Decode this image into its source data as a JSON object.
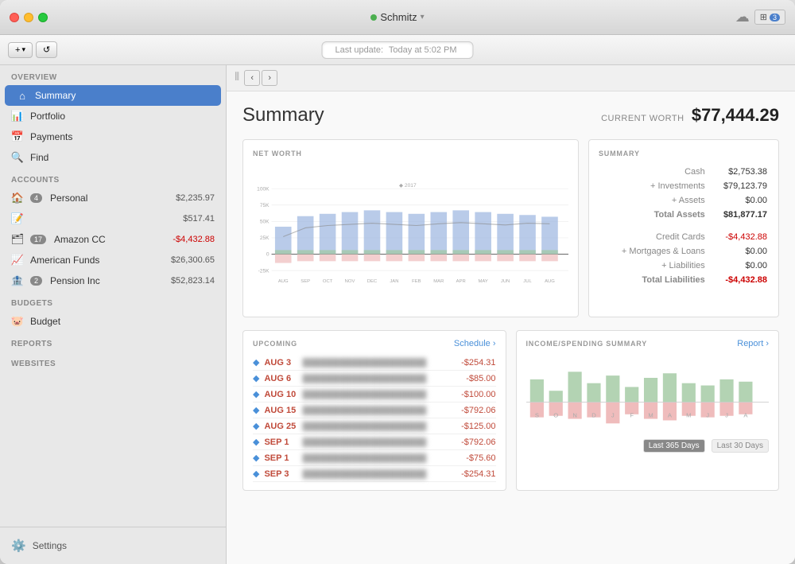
{
  "window": {
    "title": "Schmitz",
    "title_dot_color": "#4CAF50"
  },
  "toolbar": {
    "add_label": "+",
    "refresh_label": "↺",
    "last_update_label": "Last update:",
    "last_update_time": "Today at 5:02 PM"
  },
  "sidebar": {
    "overview_label": "Overview",
    "items": [
      {
        "id": "summary",
        "label": "Summary",
        "icon": "house",
        "active": true
      },
      {
        "id": "portfolio",
        "label": "Portfolio",
        "icon": "chart"
      },
      {
        "id": "payments",
        "label": "Payments",
        "icon": "calendar"
      },
      {
        "id": "find",
        "label": "Find",
        "icon": "search"
      }
    ],
    "accounts_label": "Accounts",
    "accounts": [
      {
        "id": "personal",
        "label": "Personal",
        "badge": "4",
        "amount": "$2,235.97",
        "negative": false
      },
      {
        "id": "personal2",
        "label": "",
        "badge": "",
        "amount": "$517.41",
        "negative": false
      },
      {
        "id": "amazon",
        "label": "Amazon CC",
        "badge": "17",
        "amount": "-$4,432.88",
        "negative": true
      },
      {
        "id": "american-funds",
        "label": "American Funds",
        "badge": "",
        "amount": "$26,300.65",
        "negative": false
      },
      {
        "id": "pension",
        "label": "Pension Inc",
        "badge": "2",
        "amount": "$52,823.14",
        "negative": false
      }
    ],
    "budgets_label": "Budgets",
    "budget_label": "Budget",
    "reports_label": "Reports",
    "websites_label": "Websites",
    "settings_label": "Settings"
  },
  "content": {
    "title": "Summary",
    "current_worth_label": "CURRENT WORTH",
    "current_worth_value": "$77,444.29",
    "net_worth_label": "NET WORTH",
    "summary_label": "SUMMARY",
    "summary_year": "2017",
    "chart_months": [
      "AUG",
      "SEP",
      "OCT",
      "NOV",
      "DEC",
      "JAN",
      "FEB",
      "MAR",
      "APR",
      "MAY",
      "JUN",
      "JUL",
      "AUG"
    ],
    "chart_y_labels": [
      "100K",
      "75K",
      "50K",
      "25K",
      "0",
      "-25K"
    ],
    "summary_rows": [
      {
        "label": "Cash",
        "value": "$2,753.38",
        "type": "normal"
      },
      {
        "label": "+ Investments",
        "value": "$79,123.79",
        "type": "normal"
      },
      {
        "label": "+ Assets",
        "value": "$0.00",
        "type": "normal"
      },
      {
        "label": "Total Assets",
        "value": "$81,877.17",
        "type": "total"
      },
      {
        "label": "",
        "value": "",
        "type": "gap"
      },
      {
        "label": "Credit Cards",
        "value": "-$4,432.88",
        "type": "normal"
      },
      {
        "label": "+ Mortgages & Loans",
        "value": "$0.00",
        "type": "normal"
      },
      {
        "label": "+ Liabilities",
        "value": "$0.00",
        "type": "normal"
      },
      {
        "label": "Total Liabilities",
        "value": "-$4,432.88",
        "type": "total"
      }
    ],
    "upcoming_label": "UPCOMING",
    "schedule_label": "Schedule ›",
    "upcoming_items": [
      {
        "date": "AUG 3",
        "amount": "-$254.31"
      },
      {
        "date": "AUG 6",
        "amount": "-$85.00"
      },
      {
        "date": "AUG 10",
        "amount": "-$100.00"
      },
      {
        "date": "AUG 15",
        "amount": "-$792.06"
      },
      {
        "date": "AUG 25",
        "amount": "-$125.00"
      },
      {
        "date": "SEP 1",
        "amount": "-$792.06"
      },
      {
        "date": "SEP 1",
        "amount": "-$75.60"
      },
      {
        "date": "SEP 3",
        "amount": "-$254.31"
      }
    ],
    "income_label": "INCOME/SPENDING SUMMARY",
    "report_label": "Report ›",
    "income_months": [
      "S",
      "O",
      "N",
      "D",
      "J",
      "F",
      "M",
      "A",
      "M",
      "J",
      "J",
      "A"
    ],
    "last_365_label": "Last 365 Days",
    "last_30_label": "Last 30 Days"
  }
}
